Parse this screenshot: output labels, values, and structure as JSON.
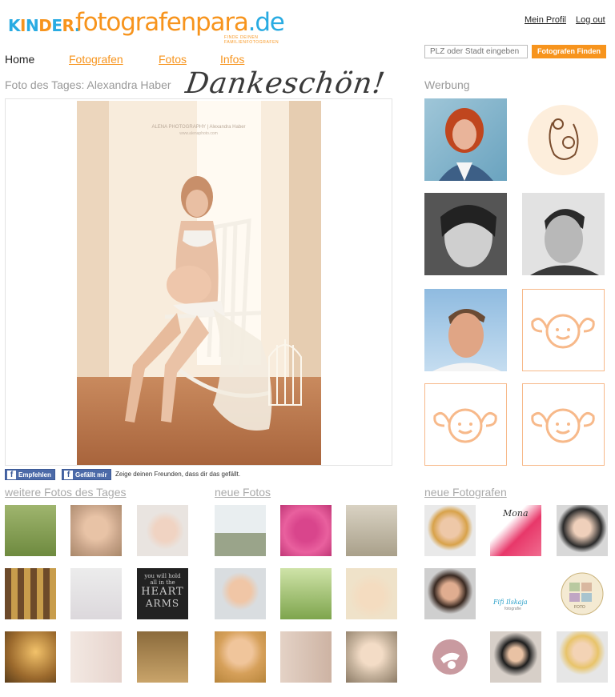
{
  "logo": {
    "kinder": "KINDER.",
    "domain_main": "fotografenpara",
    "domain_tld": ".de",
    "tagline": "FINDE DEINEN FAMILIENFOTOGRAFEN"
  },
  "toplinks": {
    "profile": "Mein Profil",
    "logout": "Log out"
  },
  "nav": {
    "home": "Home",
    "photographers": "Fotografen",
    "photos": "Fotos",
    "info": "Infos"
  },
  "search": {
    "placeholder": "PLZ oder Stadt eingeben",
    "button": "Fotografen Finden"
  },
  "photo_of_day": {
    "title": "Foto des Tages: Alexandra Haber",
    "overlay": "Dankeschön!",
    "watermark_line1": "ALENA PHOTOGRAPHY | Alexandra Haber",
    "watermark_line2": "www.alenaphoto.com"
  },
  "facebook": {
    "recommend": "Empfehlen",
    "like": "Gefällt mir",
    "text": "Zeige deinen Freunden, dass dir das gefällt."
  },
  "ads": {
    "title": "Werbung"
  },
  "sections": {
    "more_photos": "weitere Fotos des Tages",
    "new_photos": "neue Fotos",
    "new_photographers": "neue Fotografen"
  },
  "thumb_logos": {
    "mona": "Mona",
    "fifi": "Fifi Ilskaja",
    "fifi_sub": "fotografie",
    "photo_tag": "FOTO"
  },
  "quote_lines": [
    "you will hold",
    "all in the",
    "HEART",
    "ARMS"
  ],
  "colors": {
    "brand_orange": "#f7941d",
    "brand_blue": "#29abe2",
    "facebook_blue": "#4c6aa8"
  }
}
